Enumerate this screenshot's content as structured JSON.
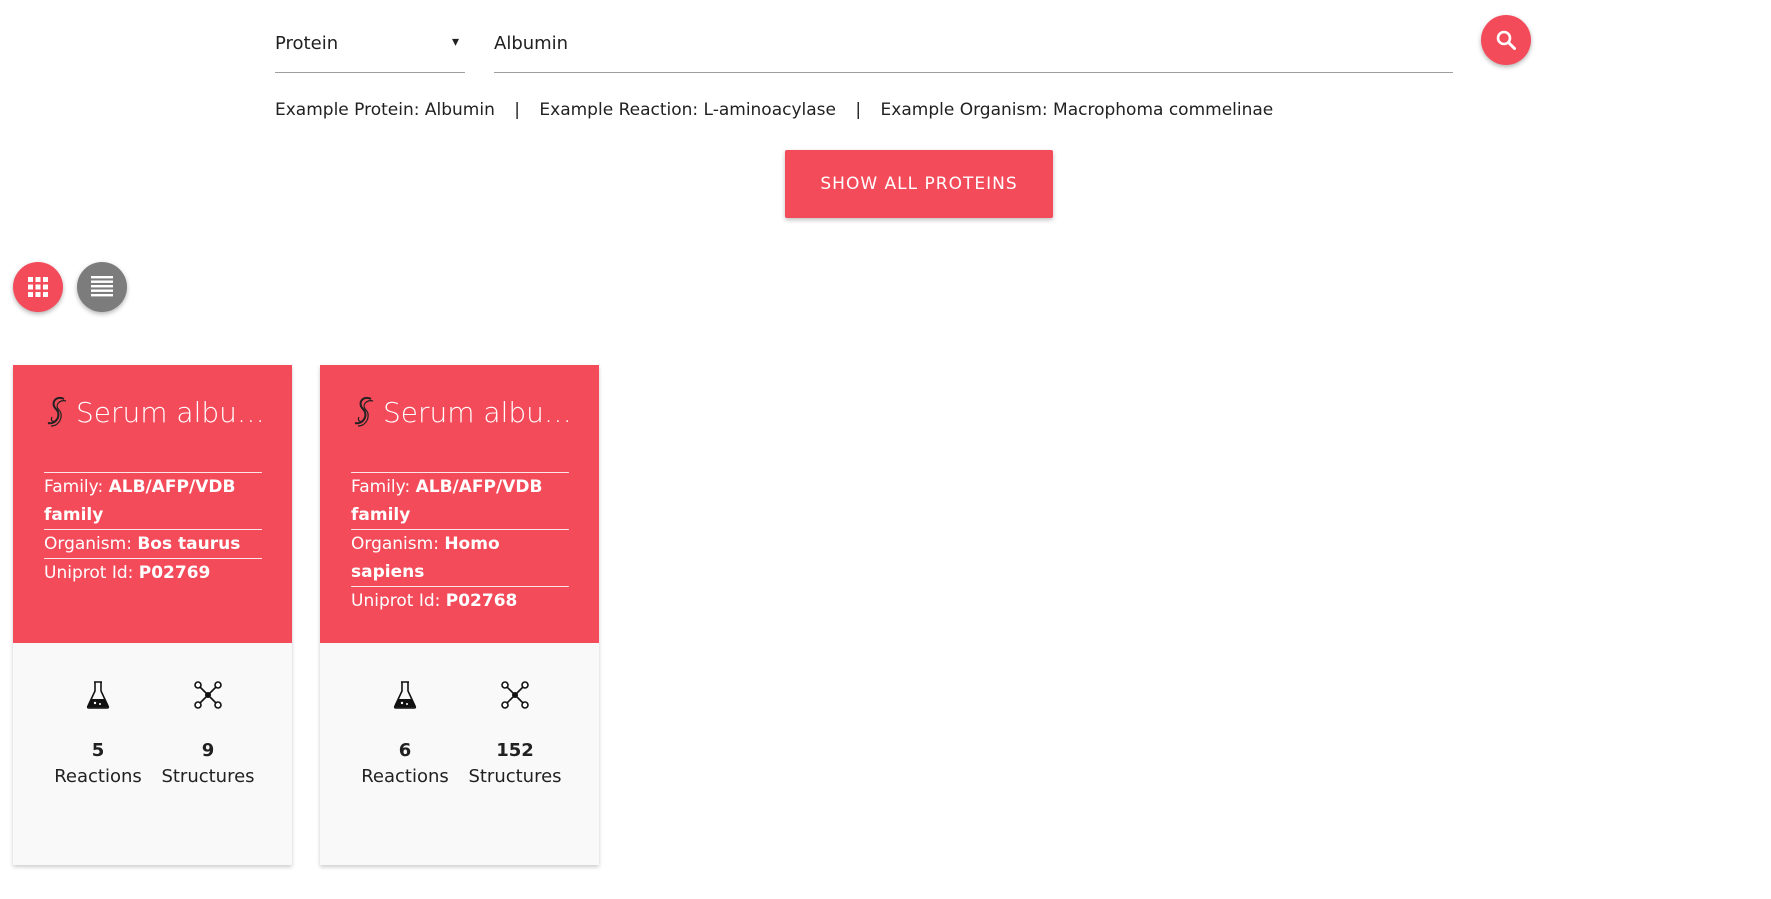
{
  "search": {
    "type_value": "Protein",
    "caret": "▾",
    "query_value": "Albumin"
  },
  "examples": {
    "protein": "Example Protein: Albumin",
    "reaction": "Example Reaction: L-aminoacylase",
    "organism": "Example Organism: Macrophoma commelinae",
    "separator": "|"
  },
  "show_all_label": "SHOW ALL PROTEINS",
  "colors": {
    "accent": "#f44b5a",
    "list_button": "#7c7c7c",
    "card_footer": "#f9f9f9"
  },
  "cards": [
    {
      "title": "Serum albu…",
      "family_label": "Family:",
      "family_value": "ALB/AFP/VDB family",
      "organism_label": "Organism:",
      "organism_value": "Bos taurus",
      "uniprot_label": "Uniprot Id:",
      "uniprot_value": "P02769",
      "reactions_count": "5",
      "reactions_label": "Reactions",
      "structures_count": "9",
      "structures_label": "Structures"
    },
    {
      "title": "Serum albu…",
      "family_label": "Family:",
      "family_value": "ALB/AFP/VDB family",
      "organism_label": "Organism:",
      "organism_value": "Homo sapiens",
      "uniprot_label": "Uniprot Id:",
      "uniprot_value": "P02768",
      "reactions_count": "6",
      "reactions_label": "Reactions",
      "structures_count": "152",
      "structures_label": "Structures"
    }
  ]
}
